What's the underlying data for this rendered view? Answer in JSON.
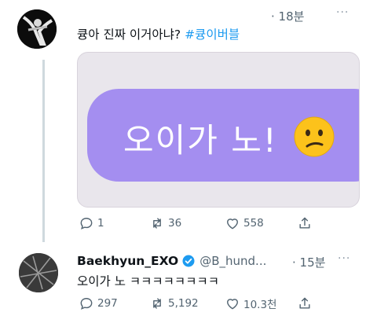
{
  "tweet1": {
    "text": "큥아 진짜 이거아냐? ",
    "hashtag": "#큥이버블",
    "time": "· 18분",
    "more": "···",
    "media_text": "오이가 노!",
    "stats": {
      "replies": "1",
      "retweets": "36",
      "likes": "558"
    }
  },
  "tweet2": {
    "name": "Baekhyun_EXO",
    "handle": "@B_hund...",
    "time": "· 15분",
    "more": "···",
    "text": "오이가 노 ㅋㅋㅋㅋㅋㅋㅋㅋ",
    "stats": {
      "replies": "297",
      "retweets": "5,192",
      "likes": "10.3천"
    }
  },
  "colors": {
    "accent": "#1d9bf0",
    "bubble": "#a48ef0",
    "muted": "#536471"
  },
  "icons": [
    "reply-icon",
    "retweet-icon",
    "like-icon",
    "share-icon",
    "verified-badge-icon",
    "confused-face-emoji"
  ]
}
